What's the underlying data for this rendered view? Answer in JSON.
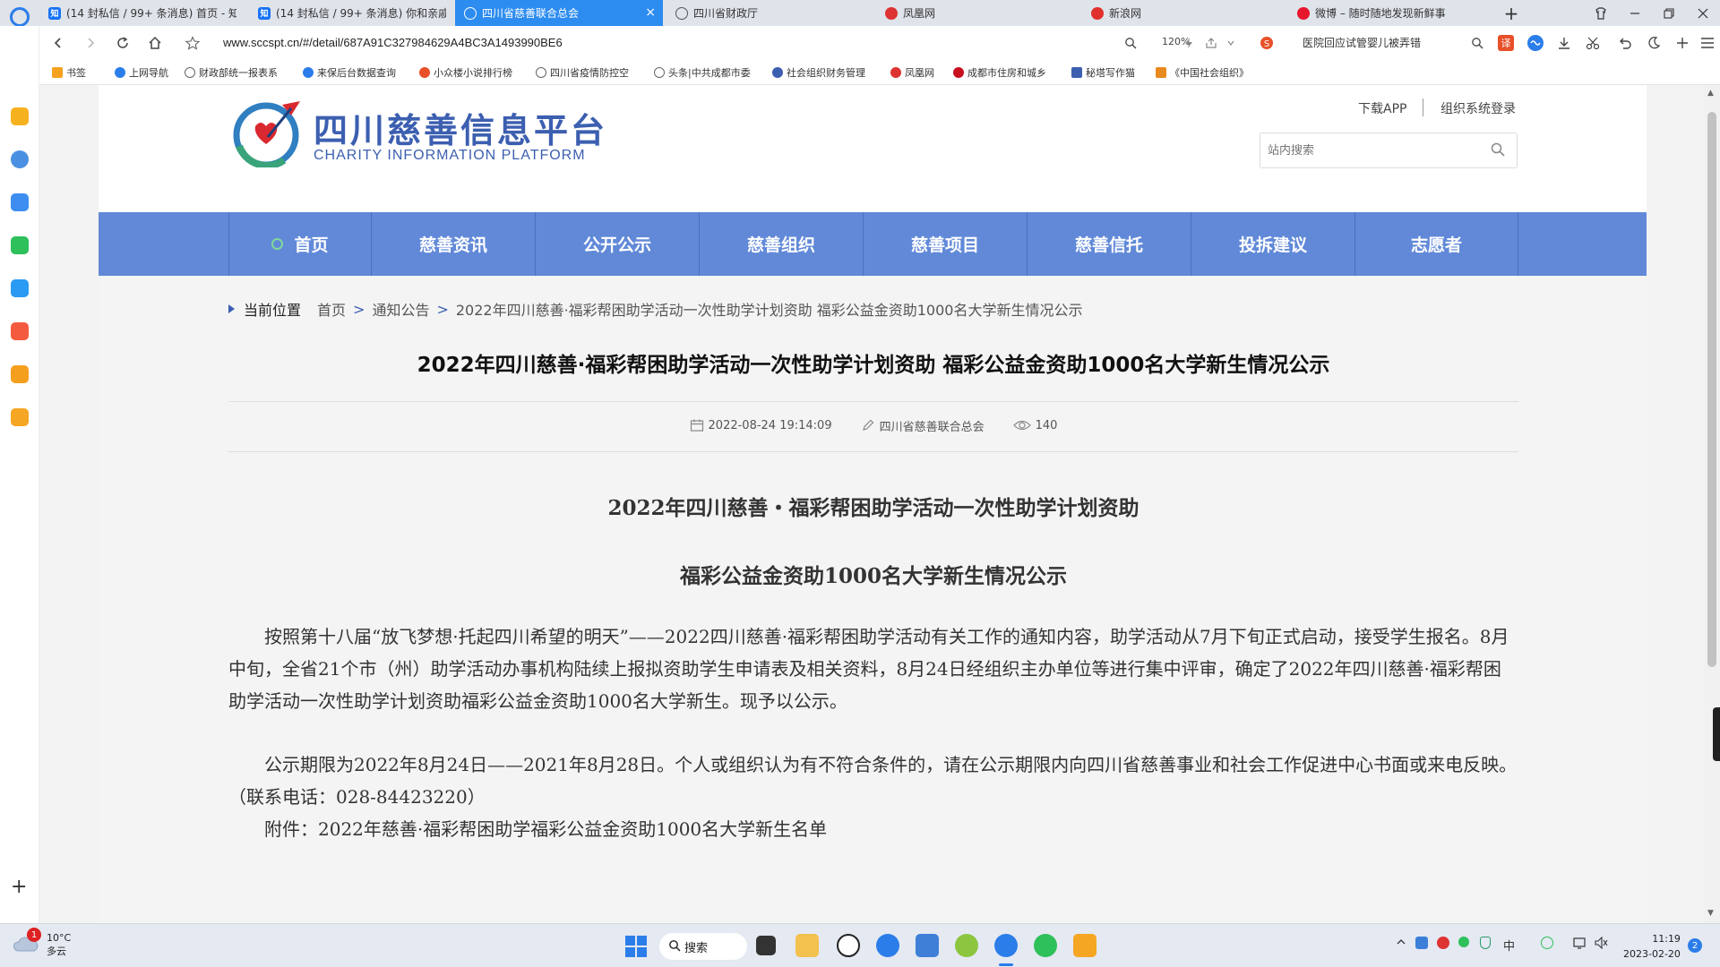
{
  "browser": {
    "tabs": [
      {
        "label": "(14 封私信 / 99+ 条消息) 首页 - 知",
        "favicon": "zhihu-favicon",
        "active": false
      },
      {
        "label": "(14 封私信 / 99+ 条消息) 你和亲戚",
        "favicon": "zhihu-favicon",
        "active": false
      },
      {
        "label": "四川省慈善联合总会",
        "favicon": "globe-favicon",
        "active": true
      },
      {
        "label": "四川省财政厅",
        "favicon": "globe-favicon",
        "active": false
      },
      {
        "label": "凤凰网",
        "favicon": "ifeng-favicon",
        "active": false
      },
      {
        "label": "新浪网",
        "favicon": "sina-favicon",
        "active": false
      },
      {
        "label": "微博 – 随时随地发现新鲜事",
        "favicon": "weibo-favicon",
        "active": false
      }
    ],
    "new_tab_symbol": "+",
    "url": "www.sccspt.cn/#/detail/687A91C327984629A4BC3A1493990BE6",
    "zoom": "120%",
    "search_hint": "医院回应试管婴儿被弄错",
    "bookmarks": [
      "书签",
      "上网导航",
      "财政部统一报表系",
      "来保后台数据查询",
      "小众楼小说排行榜",
      "四川省疫情防控空",
      "头条|中共成都市委",
      "社会组织财务管理",
      "凤凰网",
      "成都市住房和城乡",
      "秘塔写作猫",
      "《中国社会组织》"
    ]
  },
  "site": {
    "logo_cn": "四川慈善信息平台",
    "logo_en": "CHARITY INFORMATION PLATFORM",
    "top_links": {
      "download": "下载APP",
      "login": "组织系统登录"
    },
    "search_placeholder": "站内搜索",
    "nav": [
      "首页",
      "慈善资讯",
      "公开公示",
      "慈善组织",
      "慈善项目",
      "慈善信托",
      "投拆建议",
      "志愿者"
    ],
    "breadcrumb": {
      "label": "当前位置",
      "items": [
        "首页",
        "通知公告",
        "2022年四川慈善·福彩帮困助学活动一次性助学计划资助 福彩公益金资助1000名大学新生情况公示"
      ],
      "separator": ">"
    },
    "article": {
      "title": "2022年四川慈善·福彩帮困助学活动一次性助学计划资助 福彩公益金资助1000名大学新生情况公示",
      "date": "2022-08-24 19:14:09",
      "author": "四川省慈善联合总会",
      "views": "140",
      "subtitle_1": "2022年四川慈善・福彩帮困助学活动一次性助学计划资助",
      "subtitle_2": "福彩公益金资助1000名大学新生情况公示",
      "paragraph_1": "按照第十八届“放飞梦想·托起四川希望的明天”——2022四川慈善·福彩帮困助学活动有关工作的通知内容，助学活动从7月下旬正式启动，接受学生报名。8月中旬，全省21个市（州）助学活动办事机构陆续上报拟资助学生申请表及相关资料，8月24日经组织主办单位等进行集中评审，确定了2022年四川慈善·福彩帮困助学活动一次性助学计划资助福彩公益金资助1000名大学新生。现予以公示。",
      "paragraph_2": "公示期限为2022年8月24日——2021年8月28日。个人或组织认为有不符合条件的，请在公示期限内向四川省慈善事业和社会工作促进中心书面或来电反映。（联系电话：028-84423220）",
      "paragraph_3": "附件：2022年慈善·福彩帮困助学福彩公益金资助1000名大学新生名单"
    }
  },
  "taskbar": {
    "weather_temp": "10°C",
    "weather_desc": "多云",
    "weather_badge": "1",
    "search_label": "搜索",
    "ime": "中",
    "time": "11:19",
    "date": "2023-02-20",
    "notification_count": "2"
  },
  "colors": {
    "nav_bg": "#6189d8",
    "brand": "#3c5fb0",
    "tab_active": "#2d8cf0"
  }
}
